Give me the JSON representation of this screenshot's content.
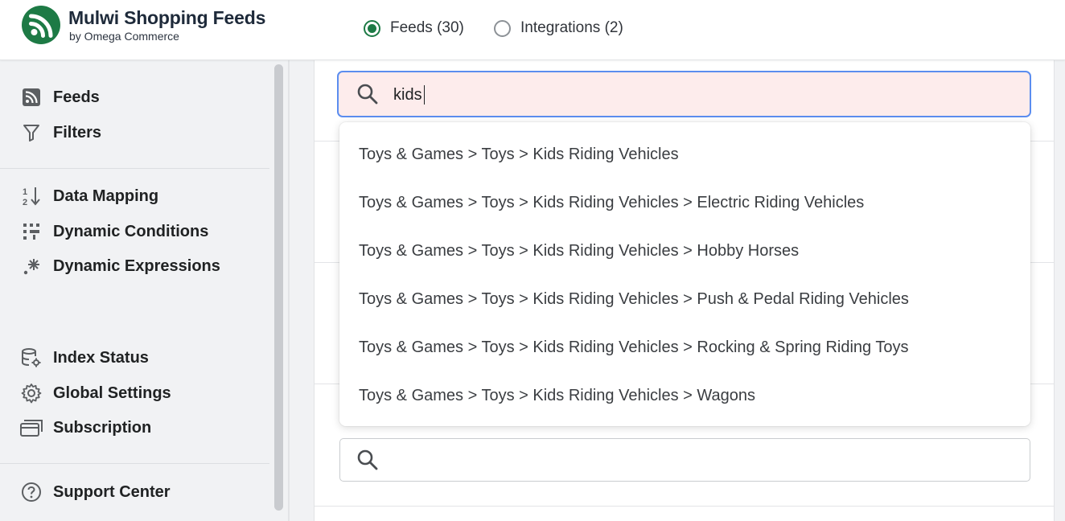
{
  "header": {
    "brand_title": "Mulwi Shopping Feeds",
    "brand_subtitle": "by Omega Commerce",
    "tabs": [
      {
        "label": "Feeds (30)",
        "selected": true
      },
      {
        "label": "Integrations (2)",
        "selected": false
      }
    ]
  },
  "sidebar": {
    "groups": [
      [
        {
          "label": "Feeds",
          "icon": "rss-icon"
        },
        {
          "label": "Filters",
          "icon": "filter-icon"
        }
      ],
      [
        {
          "label": "Data Mapping",
          "icon": "sort-icon"
        },
        {
          "label": "Dynamic Conditions",
          "icon": "conditions-icon"
        },
        {
          "label": "Dynamic Expressions",
          "icon": "sparkle-icon"
        }
      ],
      [
        {
          "label": "Index Status",
          "icon": "database-settings-icon"
        },
        {
          "label": "Global Settings",
          "icon": "gear-icon"
        },
        {
          "label": "Subscription",
          "icon": "subscription-icon"
        }
      ],
      [
        {
          "label": "Support Center",
          "icon": "help-circle-icon"
        }
      ]
    ]
  },
  "search": {
    "value": "kids",
    "suggestions": [
      "Toys & Games > Toys > Kids Riding Vehicles",
      "Toys & Games > Toys > Kids Riding Vehicles > Electric Riding Vehicles",
      "Toys & Games > Toys > Kids Riding Vehicles > Hobby Horses",
      "Toys & Games > Toys > Kids Riding Vehicles > Push & Pedal Riding Vehicles",
      "Toys & Games > Toys > Kids Riding Vehicles > Rocking & Spring Riding Toys",
      "Toys & Games > Toys > Kids Riding Vehicles > Wagons"
    ]
  },
  "second_search": {
    "value": ""
  },
  "colors": {
    "brand": "#1d7a45",
    "focus_border": "#5b8def",
    "active_input_bg": "#fdecec"
  }
}
